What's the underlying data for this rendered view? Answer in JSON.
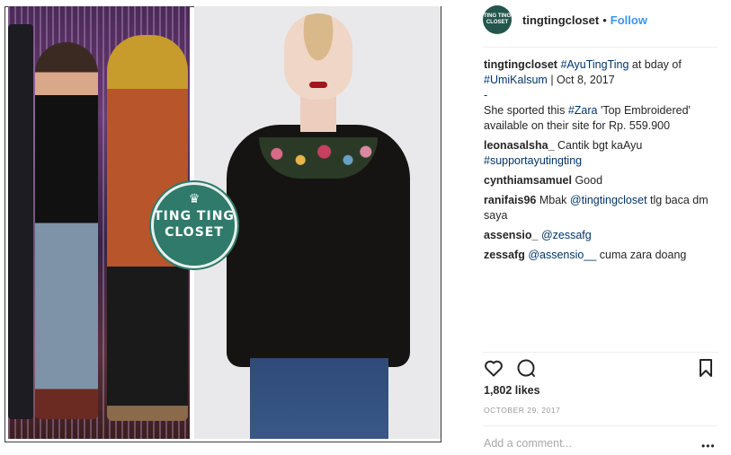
{
  "post": {
    "logo": {
      "crown": "♛",
      "line1": "TING TING",
      "line2": "CLOSET"
    }
  },
  "header": {
    "avatar_line1": "TING TING",
    "avatar_line2": "CLOSET",
    "username": "tingtingcloset",
    "separator": "•",
    "follow_label": "Follow"
  },
  "caption": {
    "user": "tingtingcloset",
    "tag1": "#AyuTingTing",
    "text1": " at bday of ",
    "tag2": "#UmiKalsum",
    "text2": " | Oct 8, 2017",
    "text3": "-",
    "text4": "She sported this ",
    "tag3": "#Zara",
    "text5": " 'Top Embroidered' available on their site for Rp. 559.900"
  },
  "comments": [
    {
      "user": "leonasalsha_",
      "pre": "Cantik bgt kaAyu ",
      "tag": "#supportayutingting",
      "post": ""
    },
    {
      "user": "cynthiamsamuel",
      "pre": "Good",
      "tag": "",
      "post": ""
    },
    {
      "user": "ranifais96",
      "pre": "Mbak ",
      "tag": "@tingtingcloset",
      "post": " tlg baca dm saya"
    },
    {
      "user": "assensio_",
      "pre": "",
      "tag": "@zessafg",
      "post": ""
    },
    {
      "user": "zessafg",
      "pre": "",
      "tag": "@assensio__",
      "post": " cuma zara doang"
    }
  ],
  "likes": "1,802 likes",
  "date": "OCTOBER 29, 2017",
  "comment_input": {
    "placeholder": "Add a comment..."
  },
  "more_glyph": "•••",
  "icons": {
    "like": "heart-icon",
    "comment": "comment-bubble-icon",
    "save": "bookmark-icon",
    "more": "more-options-icon"
  },
  "colors": {
    "link": "#3897f0",
    "hashtag": "#003569",
    "brand": "#2f7a6a"
  }
}
